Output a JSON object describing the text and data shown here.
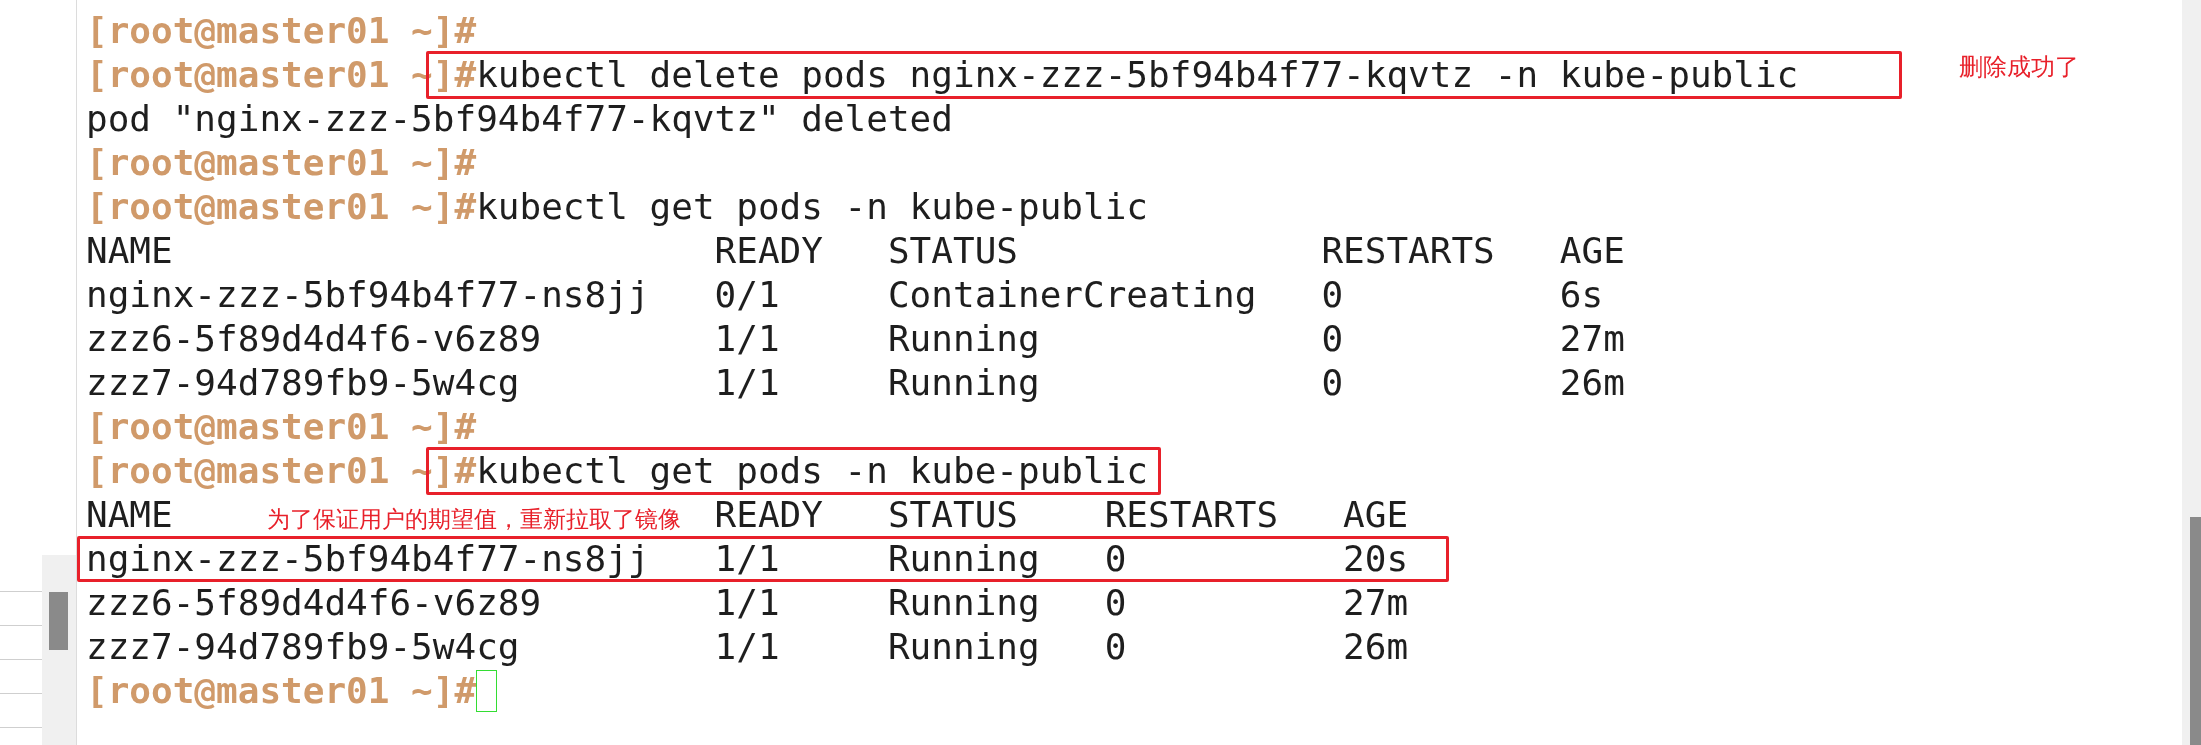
{
  "terminal": {
    "lines": [
      {
        "kind": "prompt",
        "prompt": "[root@master01 ~]#"
      },
      {
        "kind": "prompt",
        "prompt": "[root@master01 ~]#",
        "command": "kubectl delete pods nginx-zzz-5bf94b4f77-kqvtz -n kube-public",
        "highlighted": true
      },
      {
        "kind": "output",
        "text": "pod \"nginx-zzz-5bf94b4f77-kqvtz\" deleted"
      },
      {
        "kind": "prompt",
        "prompt": "[root@master01 ~]#"
      },
      {
        "kind": "prompt",
        "prompt": "[root@master01 ~]#",
        "command": "kubectl get pods -n kube-public"
      },
      {
        "kind": "table",
        "columns": [
          "NAME",
          "READY",
          "STATUS",
          "RESTARTS",
          "AGE"
        ],
        "rows": [
          {
            "cells": [
              "nginx-zzz-5bf94b4f77-ns8jj",
              "0/1",
              "ContainerCreating",
              "0",
              "6s"
            ],
            "highlighted": false
          },
          {
            "cells": [
              "zzz6-5f89d4d4f6-v6z89",
              "1/1",
              "Running",
              "0",
              "27m"
            ],
            "highlighted": false
          },
          {
            "cells": [
              "zzz7-94d789fb9-5w4cg",
              "1/1",
              "Running",
              "0",
              "26m"
            ],
            "highlighted": false
          }
        ]
      },
      {
        "kind": "prompt",
        "prompt": "[root@master01 ~]#"
      },
      {
        "kind": "prompt",
        "prompt": "[root@master01 ~]#",
        "command": "kubectl get pods -n kube-public",
        "highlighted": true
      },
      {
        "kind": "table",
        "columns": [
          "NAME",
          "READY",
          "STATUS",
          "RESTARTS",
          "AGE"
        ],
        "rows": [
          {
            "cells": [
              "nginx-zzz-5bf94b4f77-ns8jj",
              "1/1",
              "Running",
              "0",
              "20s"
            ],
            "highlighted": true
          },
          {
            "cells": [
              "zzz6-5f89d4d4f6-v6z89",
              "1/1",
              "Running",
              "0",
              "27m"
            ],
            "highlighted": false
          },
          {
            "cells": [
              "zzz7-94d789fb9-5w4cg",
              "1/1",
              "Running",
              "0",
              "26m"
            ],
            "highlighted": false
          }
        ]
      },
      {
        "kind": "prompt",
        "prompt": "[root@master01 ~]#",
        "cursor": true
      }
    ]
  },
  "annotations": [
    "删除成功了",
    "为了保证用户的期望值，重新拉取了镜像"
  ]
}
